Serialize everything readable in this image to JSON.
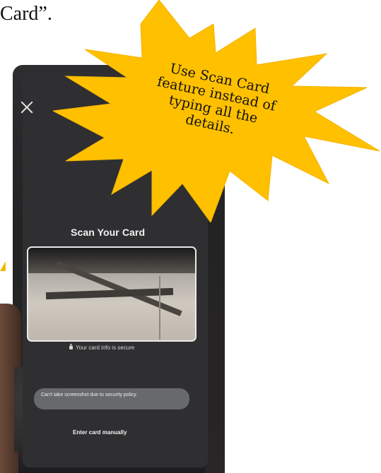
{
  "doc": {
    "text": "Card”."
  },
  "callout": {
    "lines": [
      "Use Scan Card",
      "feature instead of",
      "typing all the",
      "details."
    ]
  },
  "phone": {
    "title": "Scan Your Card",
    "secure_text": "Your card info is secure",
    "toast_text": "Can't take screenshot due to security policy.",
    "manual_button": "Enter card manually"
  },
  "colors": {
    "star_fill": "#FFC000",
    "star_outline": "#F4B400"
  }
}
